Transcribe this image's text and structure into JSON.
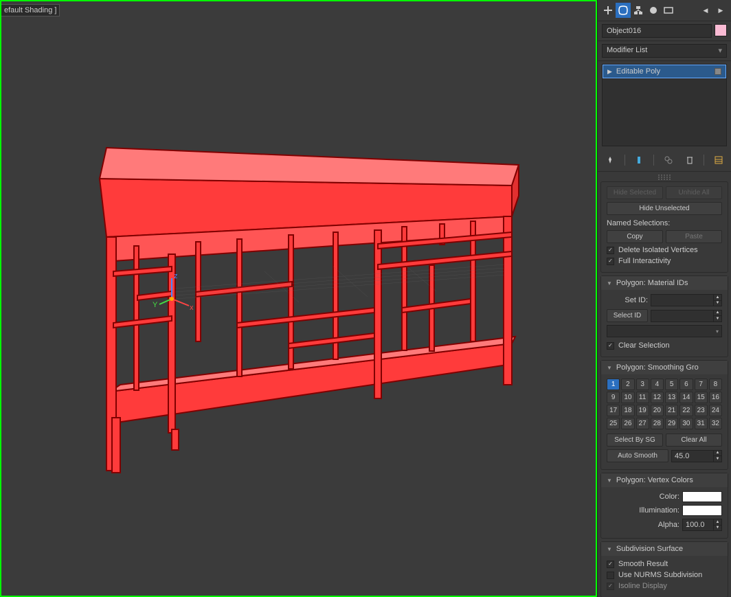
{
  "viewport": {
    "label": "efault Shading ]",
    "gizmo": {
      "x": "x",
      "y": "Y",
      "z": "z"
    }
  },
  "panel": {
    "object_name": "Object016",
    "modifier_list_label": "Modifier List",
    "stack": {
      "item": "Editable Poly"
    }
  },
  "hidden_area": {
    "btn_hide_selected": "Hide Selected",
    "btn_unhide_all": "Unhide All",
    "btn_hide_unselected": "Hide Unselected",
    "named_selections": "Named Selections:",
    "copy": "Copy",
    "paste": "Paste",
    "delete_iso": "Delete Isolated Vertices",
    "full_interactivity": "Full Interactivity"
  },
  "material_ids": {
    "title": "Polygon: Material IDs",
    "set_id": "Set ID:",
    "select_id": "Select ID",
    "clear_selection": "Clear Selection"
  },
  "smoothing": {
    "title": "Polygon: Smoothing Gro",
    "groups": [
      "1",
      "2",
      "3",
      "4",
      "5",
      "6",
      "7",
      "8",
      "9",
      "10",
      "11",
      "12",
      "13",
      "14",
      "15",
      "16",
      "17",
      "18",
      "19",
      "20",
      "21",
      "22",
      "23",
      "24",
      "25",
      "26",
      "27",
      "28",
      "29",
      "30",
      "31",
      "32"
    ],
    "selected": "1",
    "select_by_sg": "Select By SG",
    "clear_all": "Clear All",
    "auto_smooth": "Auto Smooth",
    "auto_smooth_val": "45.0"
  },
  "vertex_colors": {
    "title": "Polygon: Vertex Colors",
    "color": "Color:",
    "illumination": "Illumination:",
    "alpha": "Alpha:",
    "alpha_val": "100.0"
  },
  "subdivision": {
    "title": "Subdivision Surface",
    "smooth_result": "Smooth Result",
    "use_nurms": "Use NURMS Subdivision",
    "isoline": "Isoline Display"
  }
}
